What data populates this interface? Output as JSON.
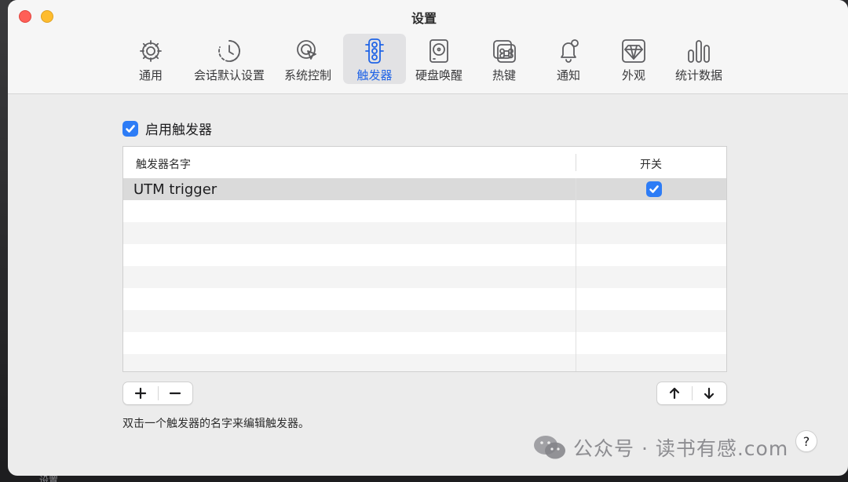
{
  "window": {
    "title": "设置"
  },
  "toolbar": {
    "tabs": [
      {
        "id": "general",
        "label": "通用",
        "icon": "gear-icon"
      },
      {
        "id": "session",
        "label": "会话默认设置",
        "icon": "clock-history-icon"
      },
      {
        "id": "system",
        "label": "系统控制",
        "icon": "cursor-target-icon"
      },
      {
        "id": "triggers",
        "label": "触发器",
        "icon": "traffic-light-icon",
        "active": true
      },
      {
        "id": "disk",
        "label": "硬盘唤醒",
        "icon": "hard-drive-icon"
      },
      {
        "id": "hotkeys",
        "label": "热键",
        "icon": "command-key-icon"
      },
      {
        "id": "notifications",
        "label": "通知",
        "icon": "bell-icon"
      },
      {
        "id": "appearance",
        "label": "外观",
        "icon": "gem-icon"
      },
      {
        "id": "stats",
        "label": "统计数据",
        "icon": "bar-chart-icon"
      }
    ]
  },
  "triggers": {
    "enable_label": "启用触发器",
    "enabled": true,
    "columns": {
      "name": "触发器名字",
      "toggle": "开关"
    },
    "rows": [
      {
        "name": "UTM trigger",
        "on": true
      }
    ],
    "hint": "双击一个触发器的名字来编辑触发器。"
  },
  "buttons": {
    "add": "+",
    "remove": "−",
    "help": "?"
  },
  "watermark": {
    "text": "公众号 · 读书有感.com"
  },
  "backdrop": {
    "label": "设置"
  },
  "colors": {
    "accent": "#2064e6",
    "checkbox": "#2d7cf6",
    "close": "#ff5f57",
    "minimize": "#febc2e"
  }
}
